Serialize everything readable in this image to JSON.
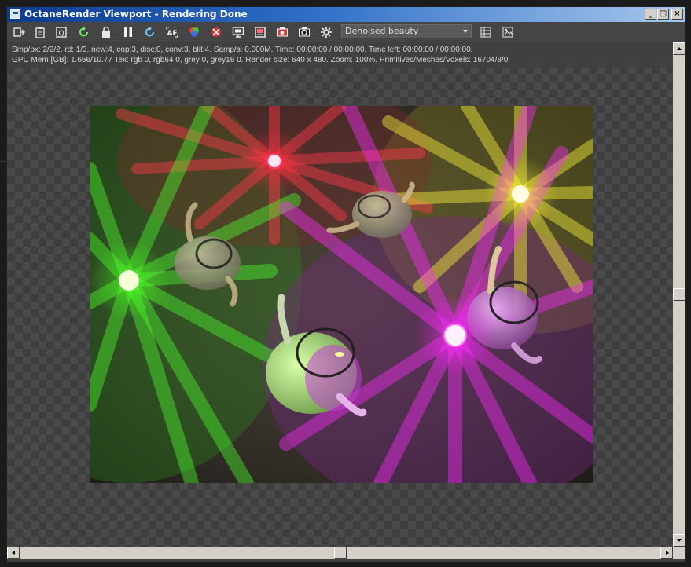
{
  "window": {
    "title": "OctaneRender Viewport - Rendering Done",
    "controls": {
      "minimize": "_",
      "maximize": "□",
      "close": "×"
    }
  },
  "toolbar": {
    "buttons": [
      "send-scene-icon",
      "clipboard-icon",
      "region-icon",
      "restart-icon",
      "lock-icon",
      "pause-icon",
      "refresh-icon",
      "autofocus-icon",
      "color-picker-icon",
      "material-picker-icon",
      "display-icon",
      "film-icon",
      "camera-icon",
      "photo-camera-icon",
      "settings-icon"
    ],
    "pass_select": {
      "value": "Denoised beauty"
    },
    "right_buttons": [
      "list-view-icon",
      "image-icon"
    ]
  },
  "stats": {
    "line1": "Smp/px: 2/2/2.   rd: 1/3.   new:4, cop:3, disc:0, conv:3, blit:4.   Samp/s: 0.000M.   Time: 00:00:00 / 00:00:00.   Time left: 00:00:00 / 00:00:00.",
    "line2": "GPU Mem [GB]: 1.656/10.77   Tex: rgb 0, rgb64 0, grey 0, grey16 0.   Render size: 640 x 480.   Zoom: 100%.   Primitives/Meshes/Voxels: 16704/8/0"
  },
  "colors": {
    "light_red": "#ff2a3c",
    "light_yellow": "#fff23a",
    "light_green": "#4dff24",
    "light_magenta": "#ff2bff",
    "title_bar_start": "#0b3c8e",
    "title_bar_end": "#a9c7ec"
  }
}
